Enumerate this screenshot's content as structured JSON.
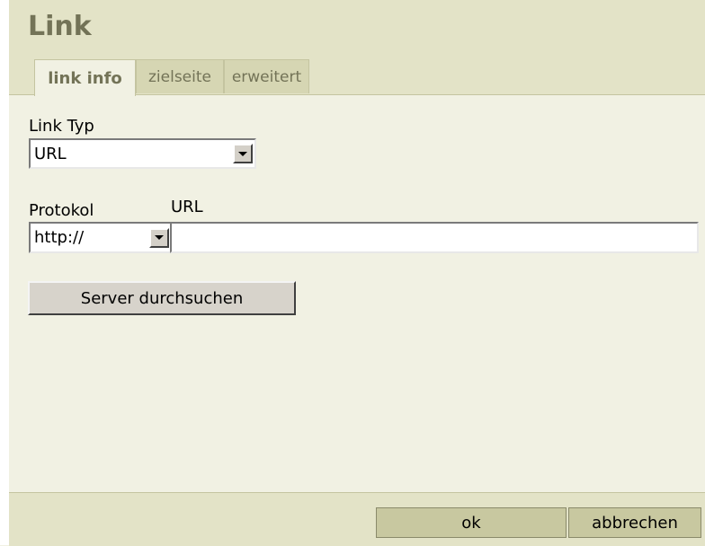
{
  "dialog": {
    "title": "Link",
    "tabs": [
      {
        "label": "link info",
        "active": true
      },
      {
        "label": "zielseite",
        "active": false
      },
      {
        "label": "erweitert",
        "active": false
      }
    ]
  },
  "link_info": {
    "link_type_label": "Link Typ",
    "link_type_value": "URL",
    "protocol_label": "Protokol",
    "protocol_value": "http://",
    "url_label": "URL",
    "url_value": "",
    "browse_server_label": "Server durchsuchen"
  },
  "footer": {
    "ok_label": "ok",
    "cancel_label": "abbrechen"
  },
  "colors": {
    "dialog_bg": "#f1f1e3",
    "header_bg": "#e3e3c7",
    "title_color": "#737357",
    "footer_button_bg": "#c8c8a0"
  },
  "icons": {
    "dropdown": "triangle-down"
  }
}
